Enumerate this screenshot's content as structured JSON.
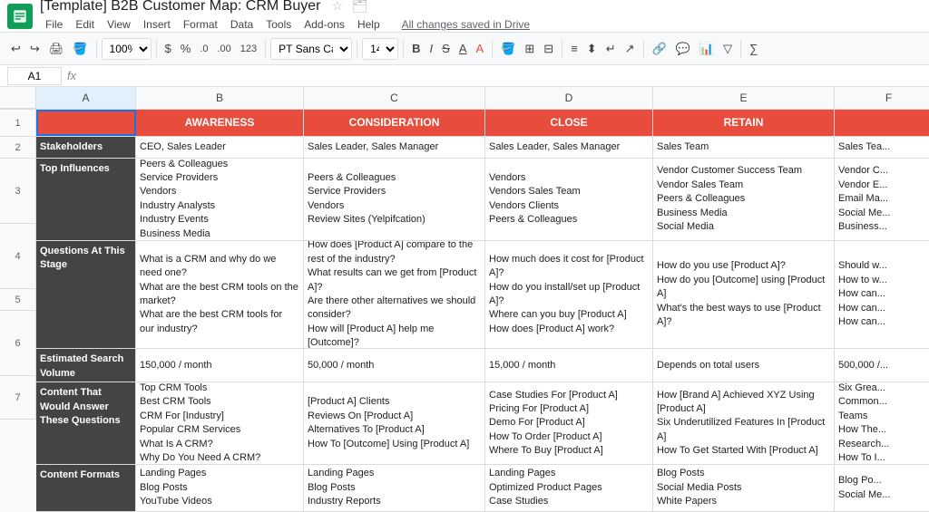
{
  "topbar": {
    "title": "[Template] B2B Customer Map: CRM Buyer",
    "save_status": "All changes saved in Drive",
    "menus": [
      "File",
      "Edit",
      "View",
      "Insert",
      "Format",
      "Data",
      "Tools",
      "Add-ons",
      "Help"
    ]
  },
  "toolbar": {
    "zoom": "100%",
    "currency": "$",
    "percent": "%",
    "decimal1": ".0",
    "decimal2": ".00",
    "format123": "123",
    "font": "PT Sans Ca...",
    "size": "14"
  },
  "formula_bar": {
    "cell_ref": "A1",
    "fx": "fx"
  },
  "columns": {
    "headers": [
      "A",
      "B",
      "C",
      "D",
      "E",
      "F"
    ],
    "labels": [
      "",
      "AWARENESS",
      "CONSIDERATION",
      "CLOSE",
      "RETAIN",
      ""
    ]
  },
  "rows": [
    {
      "num": "1",
      "cells": [
        "",
        "AWARENESS",
        "CONSIDERATION",
        "CLOSE",
        "RETAIN",
        ""
      ]
    },
    {
      "num": "2",
      "label": "Stakeholders",
      "cells": [
        "Stakeholders",
        "CEO, Sales Leader",
        "Sales Leader, Sales Manager",
        "Sales Leader, Sales Manager",
        "Sales Team",
        "Sales Tea..."
      ]
    },
    {
      "num": "3",
      "label": "Top Influences",
      "cells": [
        "Top Influences",
        "Peers & Colleagues\nService Providers\nVendors\nIndustry Analysts\nIndustry Events\nBusiness Media",
        "Peers & Colleagues\nService Providers\nVendors\nReview Sites (Yelpifcation)",
        "Vendors\nVendors Sales Team\nVendors Clients\nPeers & Colleagues",
        "Vendor Customer Success Team\nVendor Sales Team\nPeers & Colleagues\nBusiness Media\nSocial Media",
        "Vendor C...\nVendor E...\nEmail Ma...\nSocial Me...\nBusiness..."
      ]
    },
    {
      "num": "4",
      "label": "Questions At This Stage",
      "cells": [
        "Questions At This Stage",
        "What is a CRM and why do we need one?\nWhat are the best CRM tools on the market?\nWhat are the best CRM tools for our industry?",
        "How does [Product A] compare to the rest of the industry?\nWhat results can we get from [Product A]?\nAre there other alternatives we should consider?\nHow will [Product A] help me [Outcome]?",
        "How much does it cost for [Product A]?\nHow do you install/set up [Product A]?\nWhere can you buy [Product A]\nHow does [Product A] work?",
        "How do you use [Product A]?\nHow do you [Outcome] using [Product A]\nWhat's the best ways to use [Product A]?",
        "Should w...\nHow to w...\nHow can...\nHow can...\nHow can..."
      ]
    },
    {
      "num": "5",
      "label": "Estimated Search Volume",
      "cells": [
        "Estimated Search Volume",
        "150,000 / month",
        "50,000 / month",
        "15,000 / month",
        "Depends on total users",
        "500,000 /..."
      ]
    },
    {
      "num": "6",
      "label": "Content That Would Answer These Questions",
      "cells": [
        "Content That Would Answer These Questions",
        "Top CRM Tools\nBest CRM Tools\nCRM For [Industry]\nPopular CRM Services\nWhat Is A CRM?\nWhy Do You Need A CRM?",
        "[Product A] Clients\nReviews On [Product A]\nAlternatives To [Product A]\nHow To [Outcome] Using [Product A]",
        "Case Studies For [Product A]\nPricing For [Product A]\nDemo For [Product A]\nHow To Order [Product A]\nWhere To Buy [Product A]",
        "How [Brand A] Achieved XYZ Using [Product A]\nSix Underutilized Features In [Product A]\nHow To Get Started With [Product A]",
        "Six Grea...\nCommon...\nTeams\nHow The...\nResearch...\nHow To I..."
      ]
    },
    {
      "num": "7",
      "label": "Content Formats",
      "cells": [
        "Content Formats",
        "Landing Pages\nBlog Posts\nYouTube Videos",
        "Landing Pages\nBlog Posts\nIndustry Reports",
        "Landing Pages\nOptimized Product Pages\nCase Studies",
        "Blog Posts\nSocial Media Posts\nWhite Papers",
        "Blog Po...\nSocial Me..."
      ]
    }
  ]
}
